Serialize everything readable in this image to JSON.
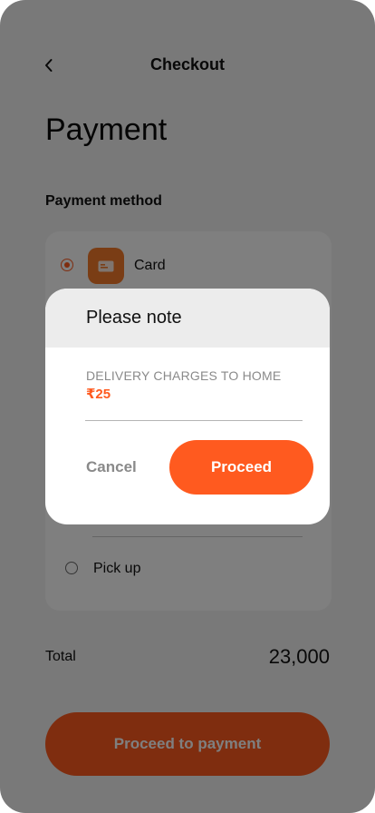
{
  "header": {
    "title": "Checkout",
    "back_icon": "chevron-left-icon"
  },
  "page": {
    "title": "Payment",
    "section_label": "Payment method"
  },
  "methods": {
    "card": {
      "label": "Card",
      "selected": true,
      "icon": "credit-card-icon",
      "icon_tile_color": "#f47a2a"
    },
    "pickup": {
      "label": "Pick up",
      "selected": false
    }
  },
  "summary": {
    "total_label": "Total",
    "total_value": "23,000"
  },
  "cta": {
    "label": "Proceed to payment"
  },
  "modal": {
    "title": "Please note",
    "notice_label": "DELIVERY CHARGES TO HOME",
    "notice_amount": "₹25",
    "cancel_label": "Cancel",
    "proceed_label": "Proceed"
  },
  "colors": {
    "accent": "#ff5a1f",
    "overlay": "rgba(0,0,0,0.5)"
  }
}
